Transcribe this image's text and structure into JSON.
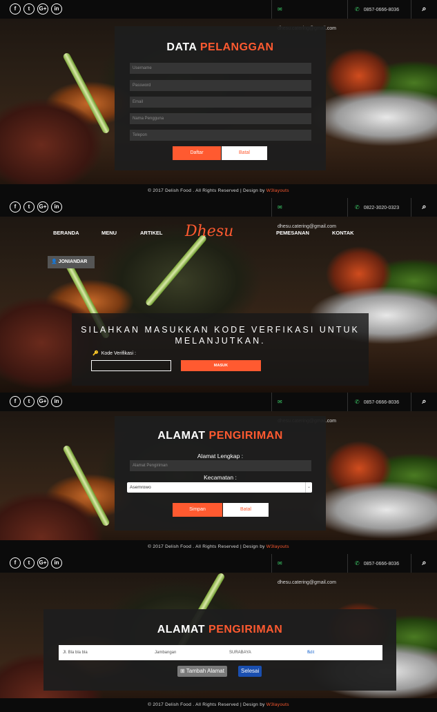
{
  "social_icons": [
    "f",
    "t",
    "G+",
    "in"
  ],
  "colors": {
    "accent": "#ff5a30",
    "topbar": "#0b0b0b",
    "card": "#1e1e1e",
    "mail_icon": "#3ecf6a"
  },
  "icons": {
    "mail": "envelope-icon",
    "phone": "phone-icon",
    "search": "search-icon"
  },
  "panel1": {
    "email": "dhesu.catering@gmail.com",
    "phone": "0857-0666-8036",
    "title_main": "DATA",
    "title_hl": "PELANGGAN",
    "fields": [
      "Username",
      "Password",
      "Email",
      "Nama Pengguna",
      "Telepon"
    ],
    "btn_submit": "Daftar",
    "btn_cancel": "Batal",
    "footer_text": "© 2017 Delish Food . All Rights Reserved | Design by",
    "footer_link": "W3layouts"
  },
  "panel2": {
    "email": "dhesu.catering@gmail.com",
    "phone": "0822-3020-0323",
    "nav_left": [
      "BERANDA",
      "MENU",
      "ARTIKEL"
    ],
    "nav_right": [
      "PEMESANAN",
      "KONTAK"
    ],
    "logo": "Dhesu",
    "user": "JONIANDAR",
    "message": "SILAHKAN MASUKKAN KODE VERFIKASI UNTUK MELANJUTKAN.",
    "code_label": "Kode Verifikasi :",
    "btn_masuk": "MASUK"
  },
  "panel3": {
    "email": "dhesu.catering@gmail.com",
    "phone": "0857-0666-8036",
    "title_main": "ALAMAT",
    "title_hl": "PENGIRIMAN",
    "address_label": "Alamat Lengkap :",
    "address_placeholder": "Alamat Pengiriman",
    "district_label": "Kecamatan :",
    "district_selected": "Asemrowo",
    "btn_save": "Simpan",
    "btn_cancel": "Batal",
    "footer_text": "© 2017 Delish Food . All Rights Reserved | Design by",
    "footer_link": "W3layouts"
  },
  "panel4": {
    "email": "dhesu.catering@gmail.com",
    "phone": "0857-0666-8036",
    "title_main": "ALAMAT",
    "title_hl": "PENGIRIMAN",
    "row": {
      "street": "Jl. Bla bla bla",
      "district": "Jambangan",
      "city": "SURABAYA",
      "edit": "Edit"
    },
    "btn_add": "Tambah Alamat",
    "btn_done": "Selesai",
    "footer_text": "© 2017 Delish Food . All Rights Reserved | Design by",
    "footer_link": "W3layouts"
  }
}
